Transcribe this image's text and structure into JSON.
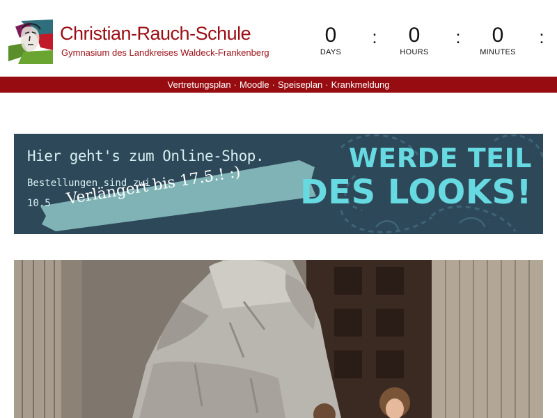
{
  "header": {
    "title": "Christian-Rauch-Schule",
    "subtitle": "Gymnasium des Landkreises Waldeck-Frankenberg",
    "logo_icon": "school-portrait-logo-icon"
  },
  "countdown": {
    "days": {
      "value": "0",
      "label": "DAYS"
    },
    "hours": {
      "value": "0",
      "label": "HOURS"
    },
    "minutes": {
      "value": "0",
      "label": "MINUTES"
    },
    "separator": ":"
  },
  "nav": {
    "items": [
      {
        "label": "Vertretungsplan"
      },
      {
        "label": "Moodle"
      },
      {
        "label": "Speiseplan"
      },
      {
        "label": "Krankmeldung"
      }
    ],
    "separator": "·"
  },
  "banner": {
    "line1": "Hier geht's zum Online-Shop.",
    "line2": "Bestellungen sind zwi",
    "line3": "10.5",
    "tape_text": "Verlängert bis 17.5.! :)",
    "headline_line1": "WERDE TEIL",
    "headline_line2": "DES LOOKS!",
    "colors": {
      "background": "#2d4858",
      "accent": "#66d9e1",
      "tape": "#7fb3b6"
    }
  },
  "photo": {
    "subject": "statue-with-columns-photo"
  },
  "colors": {
    "brand": "#9b0d14",
    "navbar": "#970c10"
  }
}
